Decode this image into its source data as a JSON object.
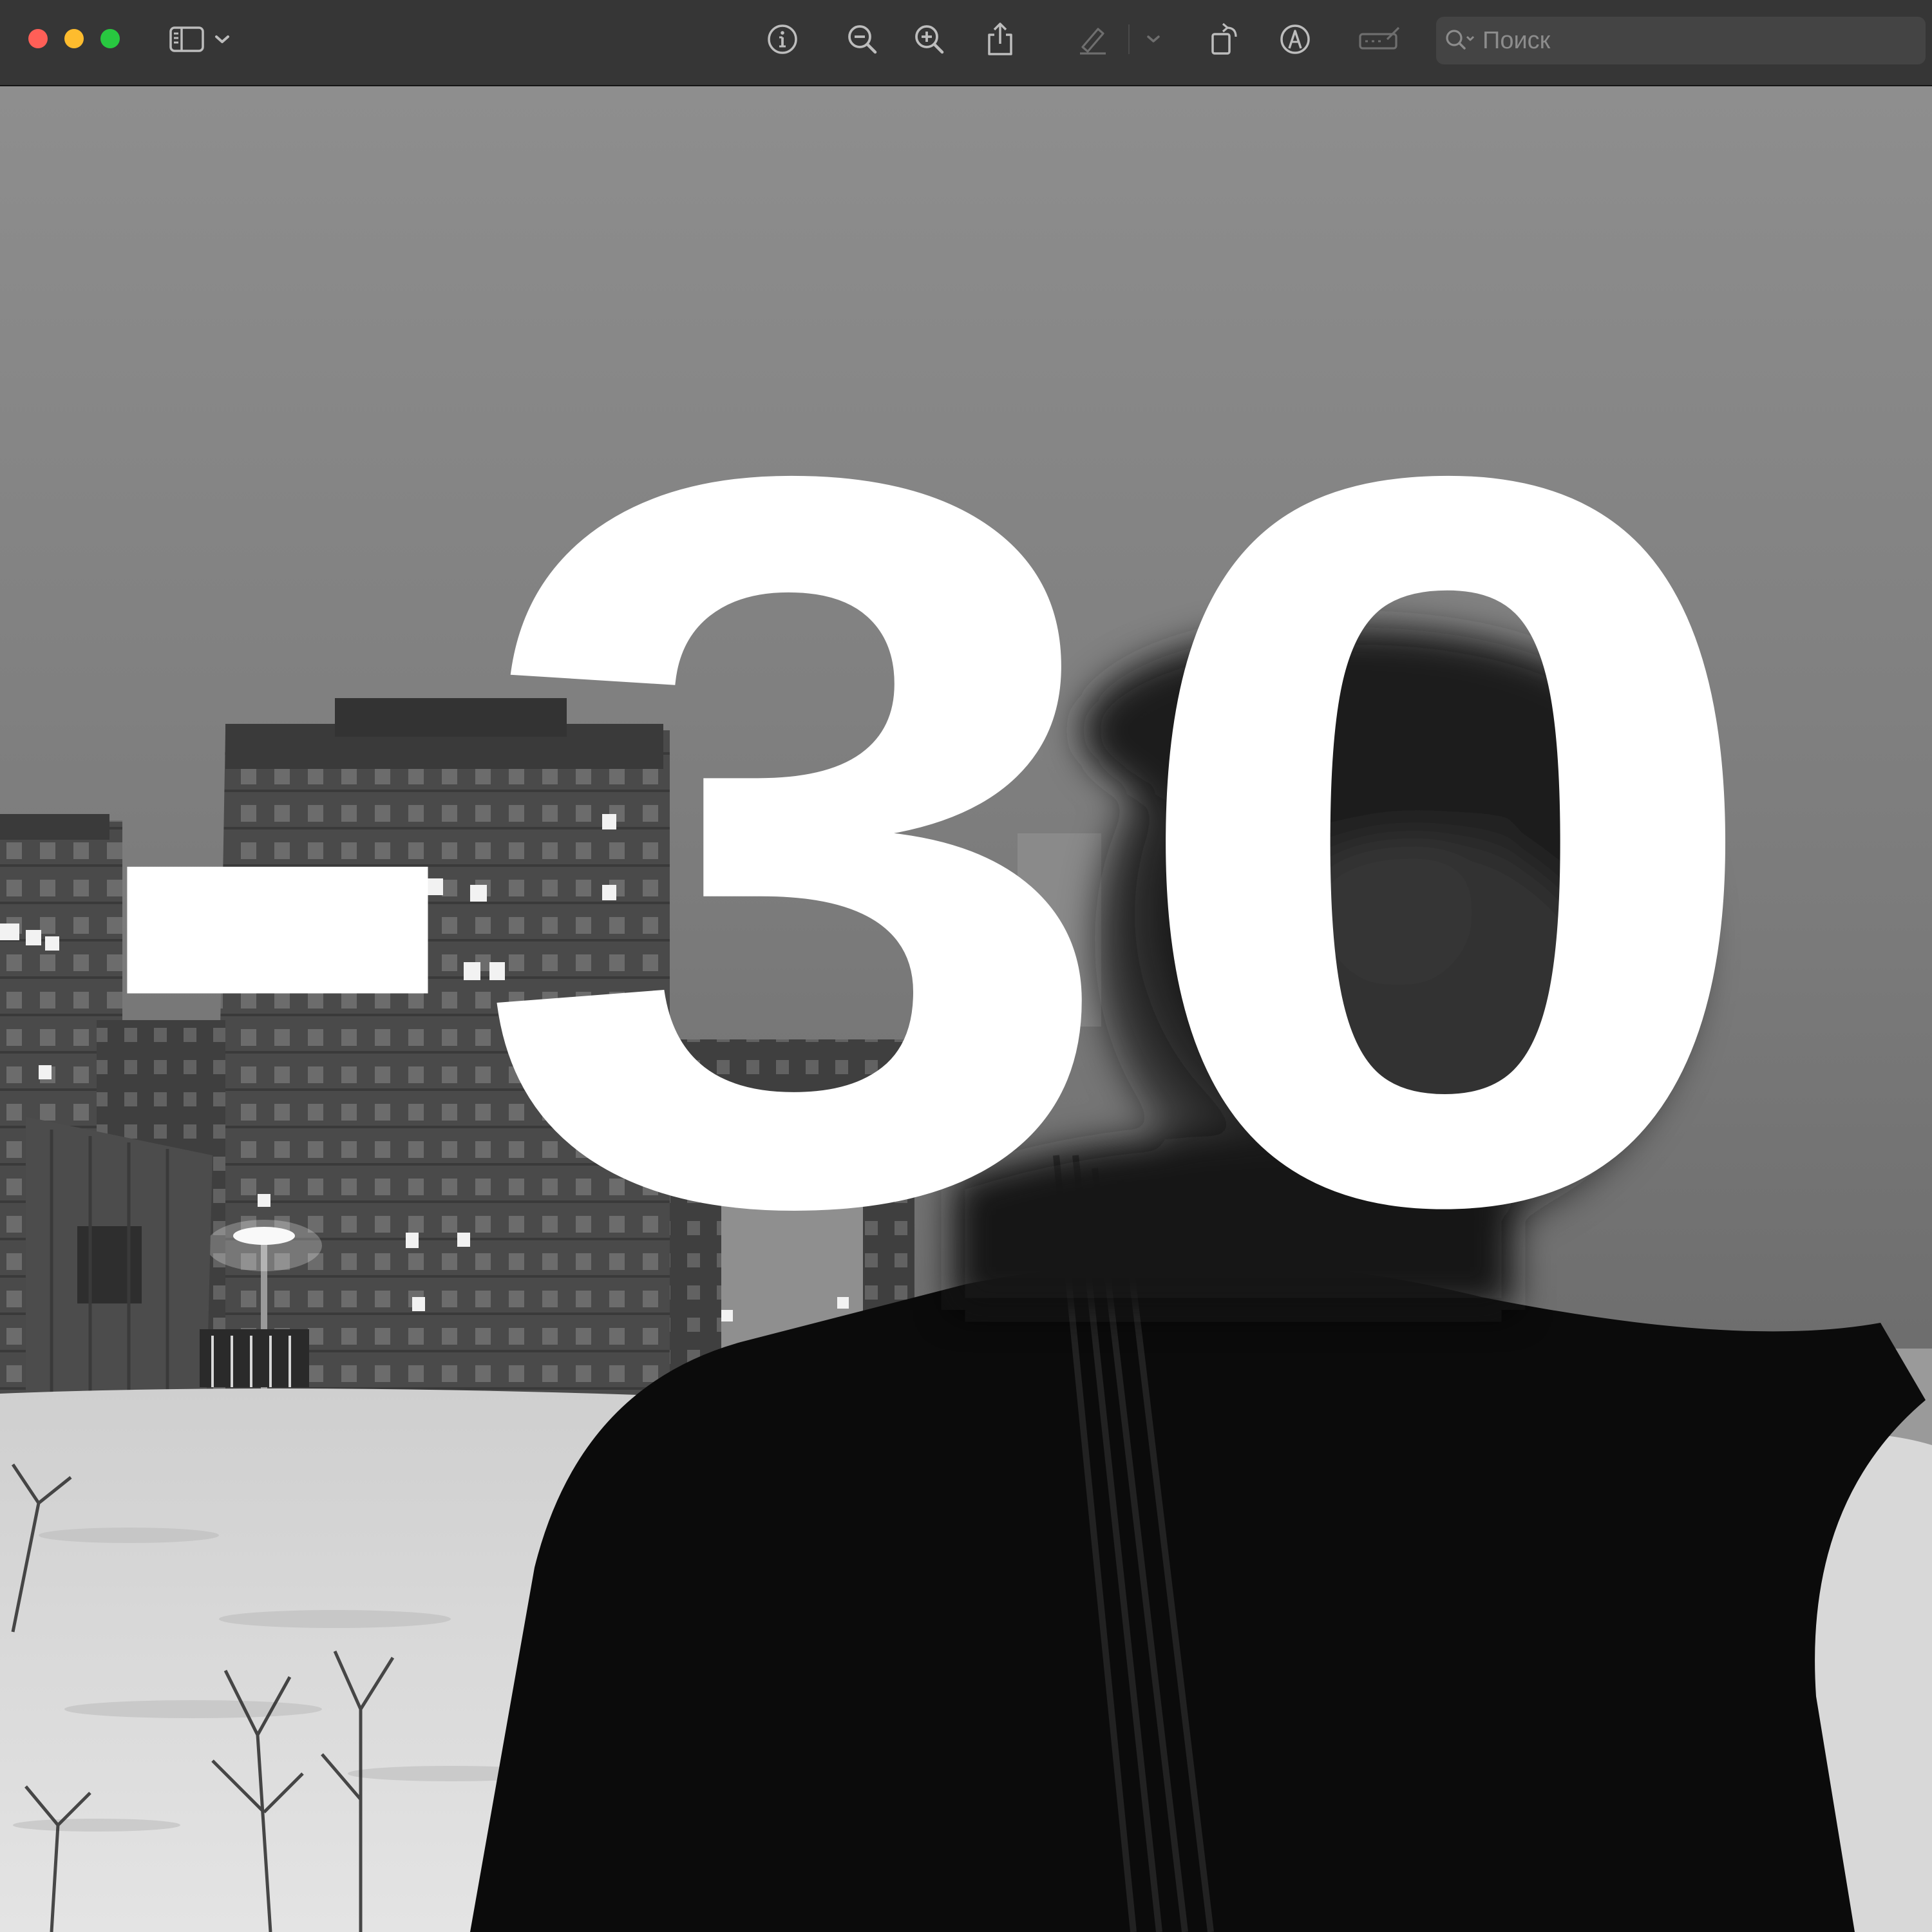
{
  "window": {
    "controls": {
      "close_color": "#ff5f57",
      "minimize_color": "#febc2e",
      "zoom_color": "#28c840"
    }
  },
  "toolbar": {
    "icons": [
      "sidebar-toggle-icon",
      "chevron-down-icon",
      "info-icon",
      "zoom-out-icon",
      "zoom-in-icon",
      "share-icon",
      "highlight-pen-icon",
      "rotate-icon",
      "markup-icon",
      "form-fill-icon",
      "search-icon"
    ],
    "search": {
      "placeholder": "Поиск",
      "value": ""
    }
  },
  "document": {
    "overlay_text": "-30",
    "overlay_color": "#ffffff"
  }
}
